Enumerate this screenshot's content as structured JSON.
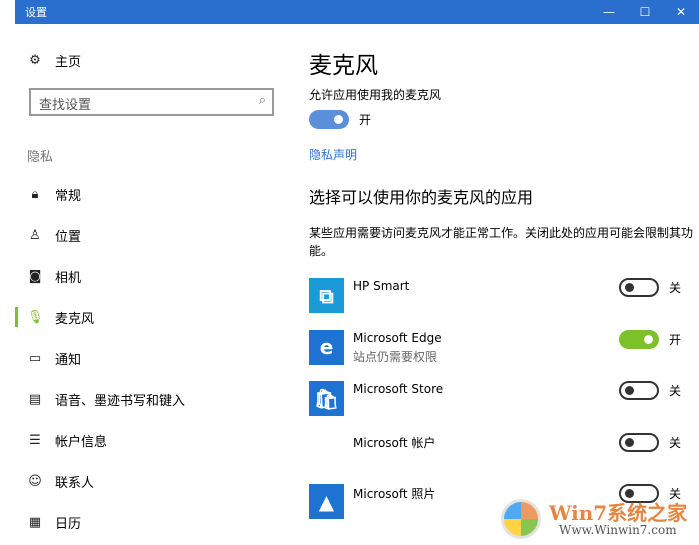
{
  "window": {
    "title": "设置",
    "minimize": "—",
    "maximize": "☐",
    "close": "✕"
  },
  "sidebar": {
    "home": "主页",
    "search_placeholder": "查找设置",
    "section": "隐私",
    "items": [
      {
        "label": "常规",
        "icon": "lock-icon",
        "glyph": "🔒︎"
      },
      {
        "label": "位置",
        "icon": "location-icon",
        "glyph": "♙"
      },
      {
        "label": "相机",
        "icon": "camera-icon",
        "glyph": "◙"
      },
      {
        "label": "麦克风",
        "icon": "microphone-icon",
        "glyph": "🎙︎",
        "active": true
      },
      {
        "label": "通知",
        "icon": "notification-icon",
        "glyph": "▭"
      },
      {
        "label": "语音、墨迹书写和键入",
        "icon": "clipboard-icon",
        "glyph": "▤"
      },
      {
        "label": "帐户信息",
        "icon": "account-info-icon",
        "glyph": "☰"
      },
      {
        "label": "联系人",
        "icon": "contacts-icon",
        "glyph": "☺"
      },
      {
        "label": "日历",
        "icon": "calendar-icon",
        "glyph": "▦"
      }
    ]
  },
  "main": {
    "title": "麦克风",
    "allow_label": "允许应用使用我的麦克风",
    "allow_state": "开",
    "allow_on": true,
    "privacy_link": "隐私声明",
    "apps_heading": "选择可以使用你的麦克风的应用",
    "description": "某些应用需要访问麦克风才能正常工作。关闭此处的应用可能会限制其功能。",
    "apps": [
      {
        "name": "HP Smart",
        "sub": "",
        "on": false,
        "state": "关",
        "icon": "hp-smart-icon",
        "color": "#1a9ad6"
      },
      {
        "name": "Microsoft Edge",
        "sub": "站点仍需要权限",
        "on": true,
        "state": "开",
        "icon": "edge-icon",
        "color": "#1e73d2"
      },
      {
        "name": "Microsoft Store",
        "sub": "",
        "on": false,
        "state": "关",
        "icon": "store-icon",
        "color": "#1e73d2"
      },
      {
        "name": "Microsoft 帐户",
        "sub": "",
        "on": false,
        "state": "关",
        "icon": "microsoft-logo-icon",
        "color": ""
      },
      {
        "name": "Microsoft 照片",
        "sub": "",
        "on": false,
        "state": "关",
        "icon": "photos-icon",
        "color": "#1e73d2"
      }
    ]
  },
  "colors": {
    "titlebar": "#2b6fce",
    "accent": "#7cc02a",
    "link": "#2b6fce"
  },
  "watermark": {
    "line1": "Win7系统之家",
    "line2": "Www.Winwin7.com"
  }
}
